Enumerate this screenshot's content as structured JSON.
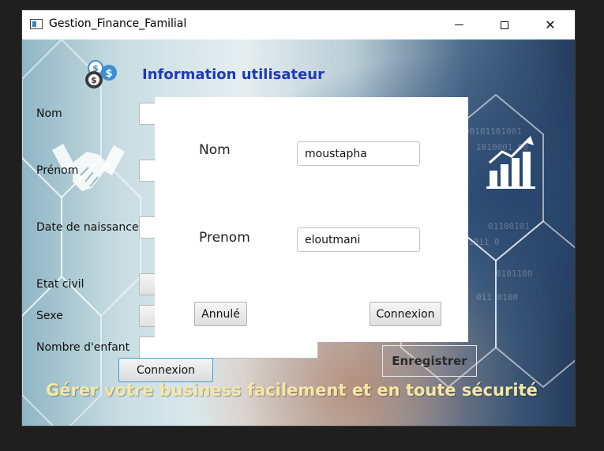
{
  "window": {
    "title": "Gestion_Finance_Familial",
    "controls": {
      "minimize": "",
      "maximize": "",
      "close": "✕"
    }
  },
  "form": {
    "title": "Information utilisateur",
    "labels": {
      "nom": "Nom",
      "prenom": "Prénom",
      "date_naissance": "Date de naissance",
      "etat_civil": "Etat civil",
      "sexe": "Sexe",
      "nombre_enfant": "Nombre d'enfant"
    },
    "enregistrer_label": "Enregistrer",
    "connexion_label": "Connexion",
    "slogan": "Gérer votre business facilement et en toute sécurité"
  },
  "dialog": {
    "nom_label": "Nom",
    "nom_value": "moustapha",
    "prenom_label": "Prenom",
    "prenom_value": "eloutmani",
    "cancel_label": "Annulé",
    "connexion_label": "Connexion"
  },
  "colors": {
    "title_blue": "#1d3bb5",
    "slogan_yellow": "#f6e7a4",
    "focus_blue": "#3e9ed6"
  },
  "icons": {
    "coins": "coins-icon",
    "handshake": "handshake-icon",
    "chart": "bar-chart-icon"
  }
}
